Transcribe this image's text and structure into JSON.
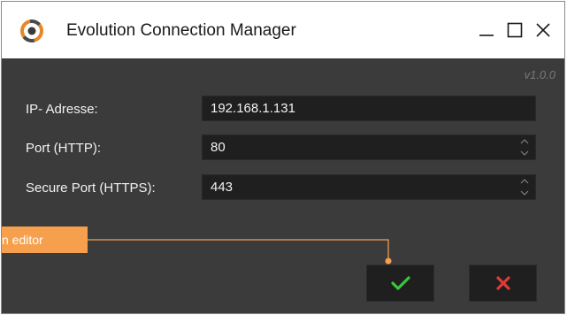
{
  "window": {
    "title": "Evolution Connection Manager",
    "version": "v1.0.0"
  },
  "fields": [
    {
      "label": "IP- Adresse:",
      "value": "192.168.1.131",
      "type": "text"
    },
    {
      "label": "Port (HTTP):",
      "value": "80",
      "type": "number"
    },
    {
      "label": "Secure Port (HTTPS):",
      "value": "443",
      "type": "number"
    }
  ],
  "callout": {
    "text": "n editor"
  },
  "buttons": {
    "ok_icon": "checkmark-icon",
    "cancel_icon": "x-icon"
  },
  "colors": {
    "accent": "#f6a04d",
    "ok": "#3cc43c",
    "cancel": "#e03a3a",
    "background": "#3b3b3b",
    "field_bg": "#1f1f1f"
  }
}
